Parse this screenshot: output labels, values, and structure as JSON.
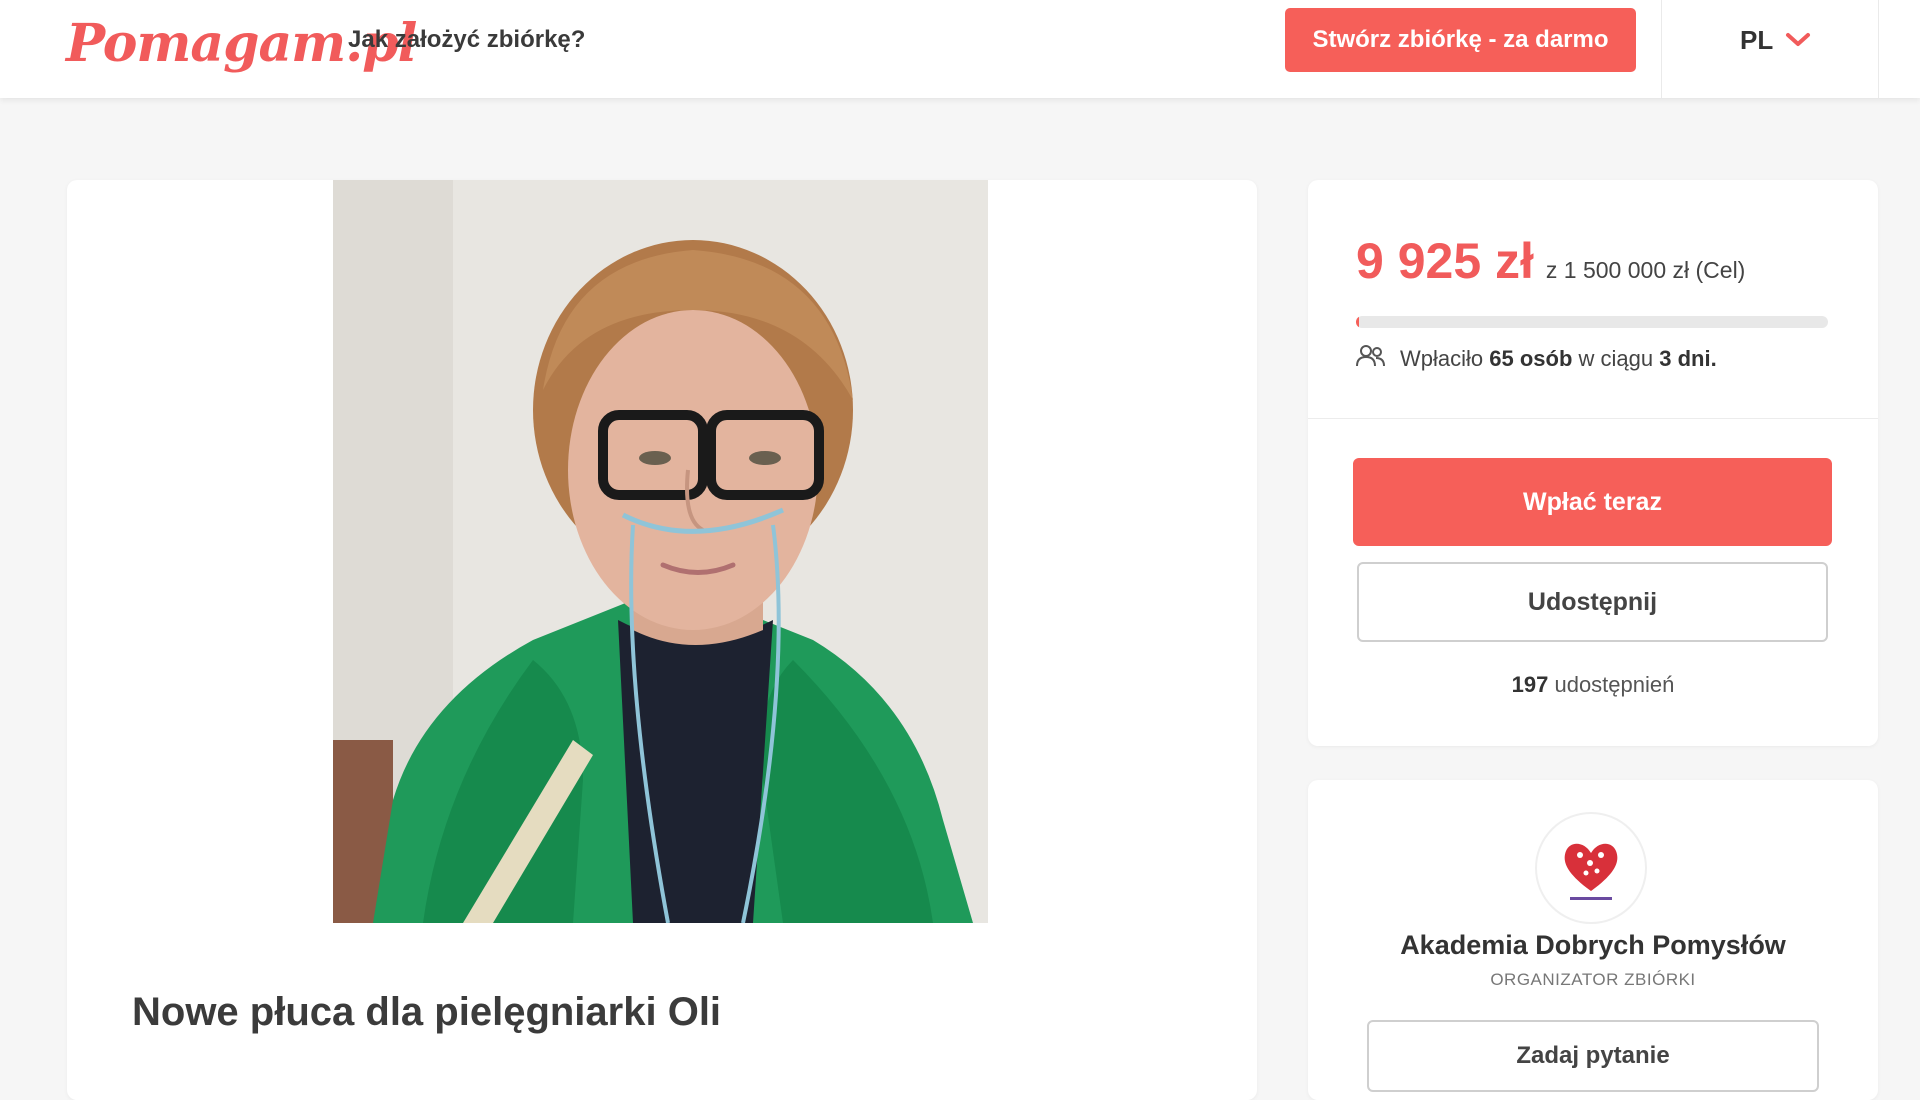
{
  "header": {
    "logo_text": "Pomagam.pl",
    "how_link": "Jak założyć zbiórkę?",
    "create_button": "Stwórz zbiórkę - za darmo",
    "language": "PL"
  },
  "campaign": {
    "title": "Nowe płuca dla pielęgniarki Oli"
  },
  "donation": {
    "amount": "9 925 zł",
    "goal": "z 1 500 000 zł (Cel)",
    "progress_fraction": 0.0066,
    "donors_prefix": "Wpłaciło",
    "donors_count": "65 osób",
    "donors_middle": "w ciągu",
    "days": "3 dni.",
    "pay_button": "Wpłać teraz",
    "share_button": "Udostępnij",
    "shares_count": "197",
    "shares_label": "udostępnień"
  },
  "organizer": {
    "name": "Akademia Dobrych Pomysłów",
    "role": "ORGANIZATOR ZBIÓRKI",
    "ask_button": "Zadaj pytanie"
  },
  "colors": {
    "brand": "#f15b5b",
    "button": "#f65f59"
  }
}
